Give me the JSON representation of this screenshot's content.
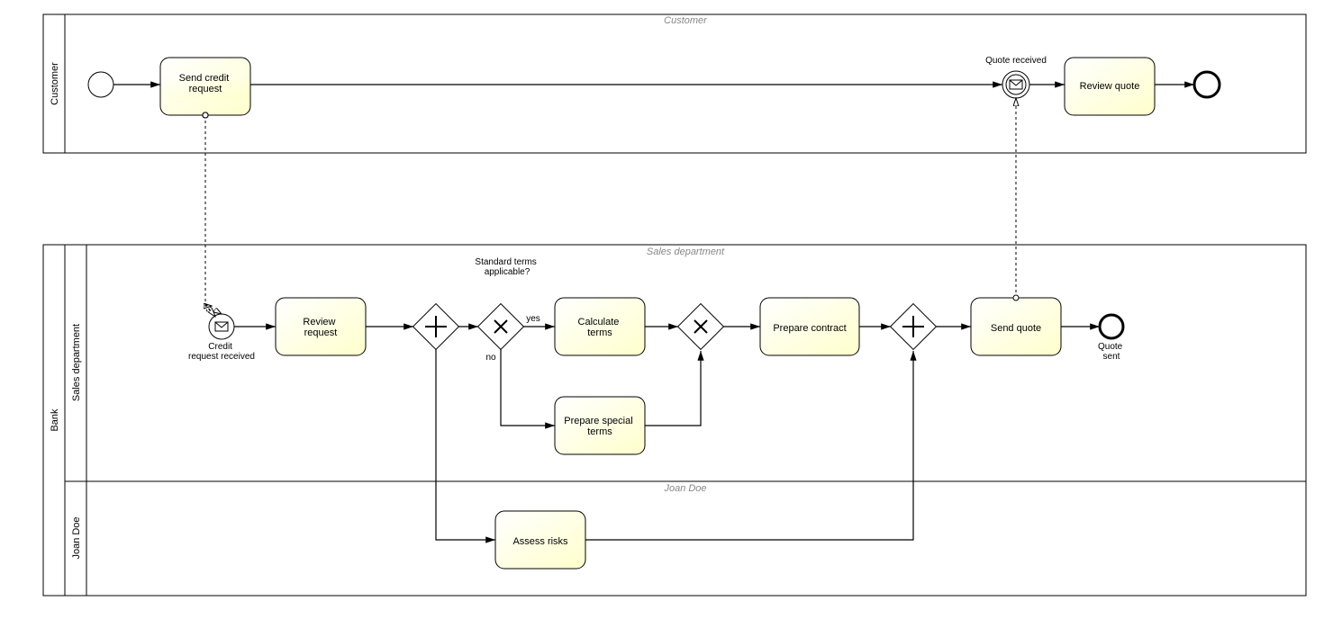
{
  "pools": {
    "customer": {
      "title": "Customer",
      "header": "Customer"
    },
    "bank": {
      "title": "Bank",
      "lanes": {
        "sales": {
          "title": "Sales department",
          "header": "Sales department"
        },
        "joan": {
          "title": "Joan Doe",
          "header": "Joan Doe"
        }
      }
    }
  },
  "tasks": {
    "send_credit_request": "Send credit request",
    "review_quote": "Review quote",
    "review_request": "Review request",
    "calculate_terms": "Calculate terms",
    "prepare_special_terms": "Prepare special terms",
    "prepare_contract": "Prepare contract",
    "send_quote": "Send quote",
    "assess_risks": "Assess risks"
  },
  "events": {
    "quote_received": "Quote received",
    "credit_request_received": "Credit request received",
    "quote_sent": "Quote sent"
  },
  "gateways": {
    "standard_terms": "Standard terms applicable?",
    "yes": "yes",
    "no": "no"
  }
}
